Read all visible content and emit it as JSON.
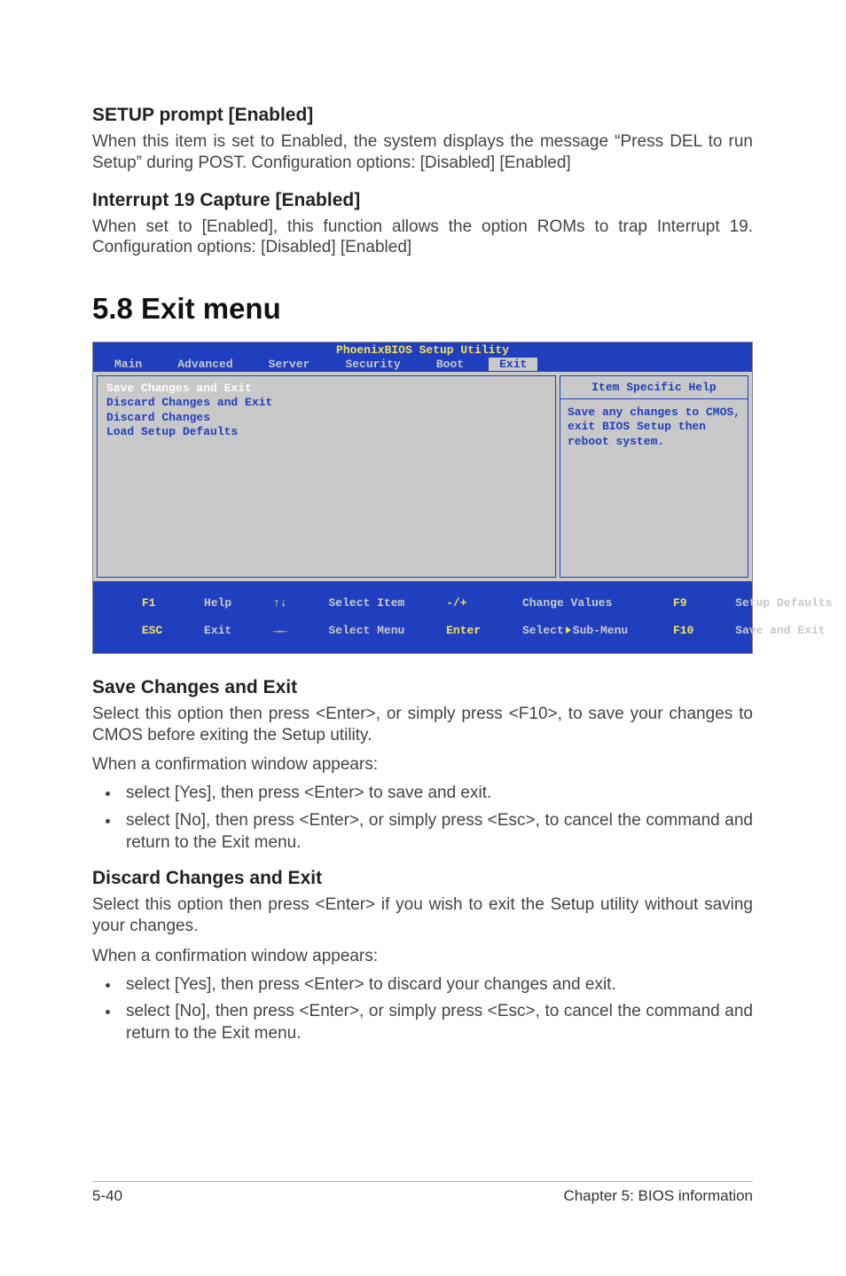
{
  "sections": {
    "setup_prompt": {
      "heading": "SETUP prompt [Enabled]",
      "body": "When this item is set to Enabled, the system displays the message “Press DEL to run Setup” during POST. Configuration options: [Disabled] [Enabled]"
    },
    "interrupt_19": {
      "heading": "Interrupt 19 Capture [Enabled]",
      "body": "When set to [Enabled], this function allows the option ROMs to trap Interrupt 19. Configuration options: [Disabled] [Enabled]"
    },
    "exit_menu": {
      "title": "5.8 Exit menu"
    },
    "save_exit": {
      "heading": "Save Changes and Exit",
      "p1": "Select this option then press <Enter>, or simply press <F10>, to save your changes to CMOS before exiting the Setup utility.",
      "p2": "When a confirmation window appears:",
      "li1": "select [Yes], then press <Enter> to save and exit.",
      "li2": "select [No], then press <Enter>, or simply press <Esc>, to cancel the command and return to the Exit menu."
    },
    "discard_exit": {
      "heading": "Discard Changes and Exit",
      "p1": "Select this option then press <Enter> if you wish to exit the Setup utility without saving your changes.",
      "p2": "When a confirmation window appears:",
      "li1": "select [Yes], then press <Enter> to discard your changes and exit.",
      "li2": "select [No], then press <Enter>, or simply press <Esc>, to cancel the command and return to the Exit menu."
    }
  },
  "bios": {
    "title": "PhoenixBIOS Setup Utility",
    "tabs": {
      "main": "Main",
      "advanced": "Advanced",
      "server": "Server",
      "security": "Security",
      "boot": "Boot",
      "exit": "Exit"
    },
    "menu": {
      "item1": "Save Changes and Exit",
      "item2": "Discard Changes and Exit",
      "item3": "Discard Changes",
      "item4": "Load Setup Defaults"
    },
    "help": {
      "title": "Item Specific Help",
      "body": "Save any changes to CMOS, exit BIOS Setup then reboot system."
    },
    "footer": {
      "f1": "F1",
      "help": "Help",
      "esc": "ESC",
      "exit": "Exit",
      "updown": "↑↓",
      "leftright": "→←",
      "select_item": "Select Item",
      "select_menu": "Select Menu",
      "minus_plus": "-/+",
      "enter": "Enter",
      "change_values": "Change Values",
      "select_sub": "Select",
      "sub_menu": "Sub-Menu",
      "f9": "F9",
      "setup_defaults": "Setup Defaults",
      "f10": "F10",
      "save_exit": "Save and Exit"
    }
  },
  "page_footer": {
    "left": "5-40",
    "right": "Chapter 5: BIOS information"
  }
}
